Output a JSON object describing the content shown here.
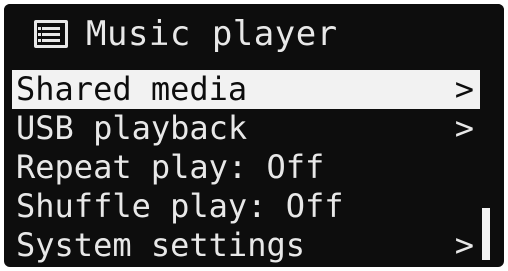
{
  "header": {
    "icon": "list-menu-icon",
    "title": "Music player"
  },
  "menu": {
    "items": [
      {
        "label": "Shared media",
        "chevron": ">",
        "selected": true
      },
      {
        "label": "USB playback",
        "chevron": ">",
        "selected": false
      },
      {
        "label": "Repeat play: Off",
        "chevron": "",
        "selected": false
      },
      {
        "label": "Shuffle play: Off",
        "chevron": "",
        "selected": false
      },
      {
        "label": "System settings",
        "chevron": ">",
        "selected": false
      }
    ]
  },
  "scrollbar": {
    "position": 0.8
  },
  "colors": {
    "background": "#0d0d0d",
    "foreground": "#e8e8e8",
    "highlight": "#f2f2f2"
  }
}
